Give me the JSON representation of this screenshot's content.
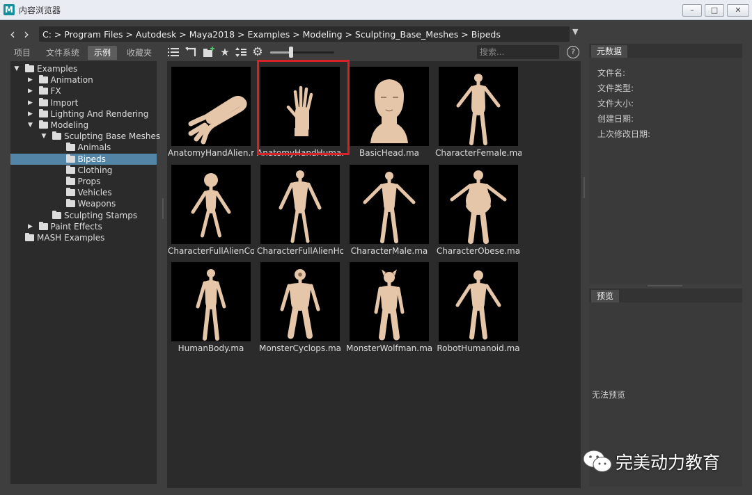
{
  "window": {
    "title": "内容浏览器",
    "app_icon": "M"
  },
  "path": {
    "text": "C:  > Program Files > Autodesk > Maya2018 > Examples > Modeling > Sculpting_Base_Meshes > Bipeds"
  },
  "tabs": [
    {
      "label": "项目",
      "active": false
    },
    {
      "label": "文件系统",
      "active": false
    },
    {
      "label": "示例",
      "active": true
    },
    {
      "label": "收藏夹",
      "active": false
    }
  ],
  "tree": [
    {
      "label": "Examples",
      "depth": 0,
      "expander": "open"
    },
    {
      "label": "Animation",
      "depth": 1,
      "expander": "closed"
    },
    {
      "label": "FX",
      "depth": 1,
      "expander": "closed"
    },
    {
      "label": "Import",
      "depth": 1,
      "expander": "closed"
    },
    {
      "label": "Lighting And Rendering",
      "depth": 1,
      "expander": "closed"
    },
    {
      "label": "Modeling",
      "depth": 1,
      "expander": "open"
    },
    {
      "label": "Sculpting Base Meshes",
      "depth": 2,
      "expander": "open"
    },
    {
      "label": "Animals",
      "depth": 3,
      "expander": "none"
    },
    {
      "label": "Bipeds",
      "depth": 3,
      "expander": "none",
      "selected": true
    },
    {
      "label": "Clothing",
      "depth": 3,
      "expander": "none"
    },
    {
      "label": "Props",
      "depth": 3,
      "expander": "none"
    },
    {
      "label": "Vehicles",
      "depth": 3,
      "expander": "none"
    },
    {
      "label": "Weapons",
      "depth": 3,
      "expander": "none"
    },
    {
      "label": "Sculpting Stamps",
      "depth": 2,
      "expander": "none"
    },
    {
      "label": "Paint Effects",
      "depth": 1,
      "expander": "closed"
    },
    {
      "label": "MASH Examples",
      "depth": 0,
      "expander": "none"
    }
  ],
  "toolbar": {
    "icons": [
      "list-view-icon",
      "back-up-icon",
      "new-folder-icon",
      "favorite-star-icon",
      "sort-icon",
      "settings-gear-icon"
    ],
    "slider_level": 0.33,
    "search_placeholder": "搜索...",
    "help": "?"
  },
  "files": [
    {
      "name": "AnatomyHandAlien.ma",
      "model": "alien-hand"
    },
    {
      "name": "AnatomyHandHuma...",
      "model": "human-hand"
    },
    {
      "name": "BasicHead.ma",
      "model": "head"
    },
    {
      "name": "CharacterFemale.ma",
      "model": "female"
    },
    {
      "name": "CharacterFullAlienCo...",
      "model": "alien-child"
    },
    {
      "name": "CharacterFullAlienHo...",
      "model": "alien-tall"
    },
    {
      "name": "CharacterMale.ma",
      "model": "male"
    },
    {
      "name": "CharacterObese.ma",
      "model": "obese"
    },
    {
      "name": "HumanBody.ma",
      "model": "human"
    },
    {
      "name": "MonsterCyclops.ma",
      "model": "cyclops"
    },
    {
      "name": "MonsterWolfman.ma",
      "model": "wolfman"
    },
    {
      "name": "RobotHumanoid.ma",
      "model": "robot"
    }
  ],
  "metadata": {
    "tab": "元数据",
    "fields": [
      "文件名:",
      "文件类型:",
      "文件大小:",
      "创建日期:",
      "上次修改日期:"
    ]
  },
  "preview": {
    "tab": "预览",
    "empty_text": "无法预览"
  },
  "watermark": {
    "text": "完美动力教育"
  },
  "colors": {
    "selection": "#5285a6",
    "highlight_box": "#d8222a",
    "model": "#e6c6a8"
  }
}
